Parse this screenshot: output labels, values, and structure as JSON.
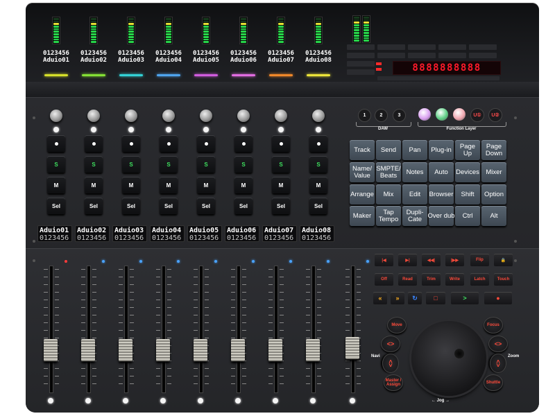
{
  "channels": [
    {
      "value": "0123456",
      "name": "Aduio01",
      "stripe": "#d6e02a"
    },
    {
      "value": "0123456",
      "name": "Aduio02",
      "stripe": "#84e035"
    },
    {
      "value": "0123456",
      "name": "Aduio03",
      "stripe": "#33d2d6"
    },
    {
      "value": "0123456",
      "name": "Aduio04",
      "stripe": "#4fa4ee"
    },
    {
      "value": "0123456",
      "name": "Aduio05",
      "stripe": "#d05cde"
    },
    {
      "value": "0123456",
      "name": "Aduio06",
      "stripe": "#e06ce0"
    },
    {
      "value": "0123456",
      "name": "Aduio07",
      "stripe": "#f0882a"
    },
    {
      "value": "0123456",
      "name": "Aduio08",
      "stripe": "#ece43a"
    }
  ],
  "strip_lcd": [
    {
      "name": "Aduio01",
      "value": "0123456"
    },
    {
      "name": "Aduio02",
      "value": "0123456"
    },
    {
      "name": "Aduio03",
      "value": "0123456"
    },
    {
      "name": "Aduio04",
      "value": "0123456"
    },
    {
      "name": "Aduio05",
      "value": "0123456"
    },
    {
      "name": "Aduio06",
      "value": "0123456"
    },
    {
      "name": "Aduio07",
      "value": "0123456"
    },
    {
      "name": "Aduio08",
      "value": "0123456"
    }
  ],
  "strip_buttons": {
    "solo": "S",
    "mute": "M",
    "select": "Sel"
  },
  "timecode": "8888888888",
  "daw": {
    "label": "DAW",
    "buttons": [
      "1",
      "2",
      "3"
    ]
  },
  "function_layer": {
    "label": "Function Layer",
    "colors": [
      "#d9a0f0",
      "#5fcf86",
      "#f0a6b0"
    ],
    "user_buttons": [
      "U①",
      "U②"
    ]
  },
  "pads": [
    [
      "Track",
      "Send",
      "Pan",
      "Plug-in",
      "Page\nUp",
      "Page\nDown"
    ],
    [
      "Name/\nValue",
      "SMPTE/\nBeats",
      "Notes",
      "Auto",
      "Devices",
      "Mixer"
    ],
    [
      "Arrange",
      "Mix",
      "Edit",
      "Browser",
      "Shift",
      "Option"
    ],
    [
      "Maker",
      "Tap\nTempo",
      "Dupli-\nCate",
      "Over dub",
      "Ctrl",
      "Alt"
    ]
  ],
  "transport_row1": [
    "|◀",
    "▶|",
    "◀◀|",
    "|▶▶",
    "Flip",
    "🔒"
  ],
  "transport_row2": [
    "Off",
    "Read",
    "Trim",
    "Write",
    "Latch",
    "Touch"
  ],
  "transport_row3": [
    "«",
    "»",
    "↻",
    "□",
    ">",
    "●"
  ],
  "nav_buttons": {
    "move": "Move",
    "focus": "Focus",
    "master": "Master /\nAssign",
    "shuttle": "Shuttle",
    "left_lr": "<>",
    "right_lr": "<>",
    "left_ud": "<>",
    "right_ud": "<>"
  },
  "labels": {
    "navi": "Navi",
    "zoom": "Zoom",
    "jog": "← Jog →"
  },
  "meter_colors": {
    "green": "#27d64a",
    "yellow": "#e6e034",
    "red": "#f03030",
    "off": "#163a1d"
  }
}
